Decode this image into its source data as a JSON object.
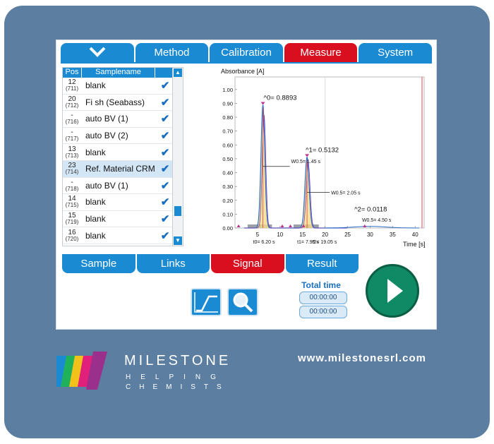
{
  "tabs": [
    "Method",
    "Calibration",
    "Measure",
    "System"
  ],
  "list": {
    "col_pos": "Pos",
    "col_name": "Samplename",
    "rows": [
      {
        "pos": "12",
        "sub": "(711)",
        "name": "blank"
      },
      {
        "pos": "20",
        "sub": "(712)",
        "name": "Fi sh (Seabass)"
      },
      {
        "pos": "-",
        "sub": "(716)",
        "name": "auto BV (1)"
      },
      {
        "pos": "-",
        "sub": "(717)",
        "name": "auto BV (2)"
      },
      {
        "pos": "13",
        "sub": "(713)",
        "name": "blank"
      },
      {
        "pos": "23",
        "sub": "(714)",
        "name": "Ref. Material CRM"
      },
      {
        "pos": "-",
        "sub": "(718)",
        "name": "auto BV (1)"
      },
      {
        "pos": "14",
        "sub": "(715)",
        "name": "blank"
      },
      {
        "pos": "15",
        "sub": "(719)",
        "name": "blank"
      },
      {
        "pos": "16",
        "sub": "(720)",
        "name": "blank"
      }
    ]
  },
  "chart_data": {
    "type": "line",
    "ylabel": "Absorbance [A]",
    "xlabel": "Time [s]",
    "xlim": [
      0,
      42
    ],
    "ylim": [
      0,
      1.05
    ],
    "x_ticks": [
      5,
      10,
      15,
      20,
      25,
      30,
      35,
      40
    ],
    "y_ticks": [
      0.0,
      0.1,
      0.2,
      0.3,
      0.4,
      0.5,
      0.6,
      0.7,
      0.8,
      0.9,
      1.0
    ],
    "peaks": [
      {
        "label": "^0= 0.8893",
        "x": 6.2,
        "height": 0.8893,
        "width_label": "W0.5= 1.45 s",
        "t_label": "t0= 6.20 s"
      },
      {
        "label": "^1= 0.5132",
        "x": 7.95,
        "height": 0.5132,
        "width_label": "W0.5= 2.05 s",
        "t_label": "t1= 7.95 s"
      },
      {
        "label": "^2= 0.0118",
        "x": 19.05,
        "height": 0.0118,
        "width_label": "W0.5= 4.50 s",
        "t_label": "t2= 19.05 s"
      }
    ],
    "pd_label": "PD"
  },
  "bottom_tabs": [
    "Sample",
    "Links",
    "Signal",
    "Result"
  ],
  "total_time": {
    "label": "Total time",
    "v1": "00:00:00",
    "v2": "00:00:00"
  },
  "footer": {
    "brand": "MILESTONE",
    "tag1": "HELPING",
    "tag2": "CHEMISTS",
    "url": "www.milestonesrl.com"
  },
  "colors": {
    "accent": "#1a8bd2",
    "active": "#d90f1f",
    "start": "#0f8a64"
  }
}
